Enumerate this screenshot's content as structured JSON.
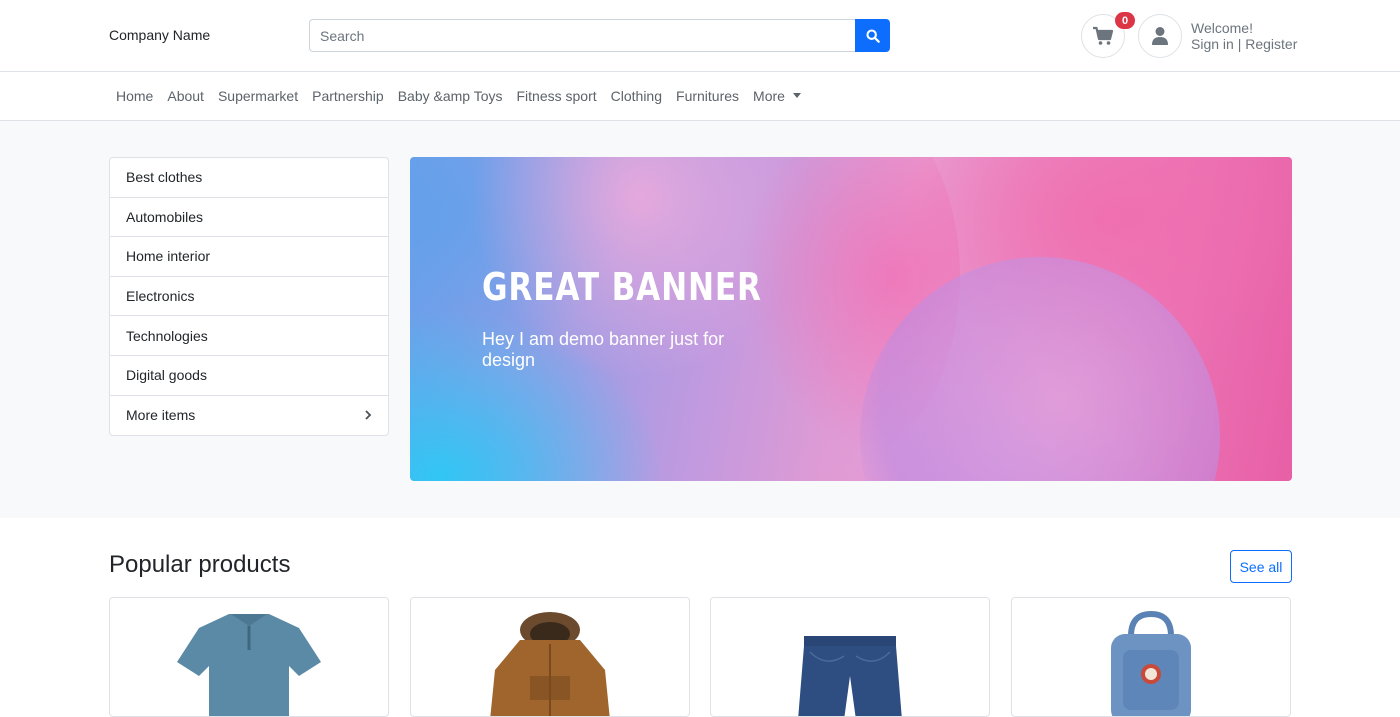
{
  "header": {
    "brand": "Company Name",
    "search_placeholder": "Search",
    "cart_count": "0",
    "welcome": "Welcome!",
    "sign_in": "Sign in",
    "separator": " | ",
    "register": "Register",
    "icons": {
      "search": "search-icon",
      "cart": "cart-icon",
      "user": "user-icon"
    },
    "accent_color": "#0d6efd",
    "badge_color": "#dc3545"
  },
  "nav": {
    "items": [
      "Home",
      "About",
      "Supermarket",
      "Partnership",
      "Baby &amp Toys",
      "Fitness sport",
      "Clothing",
      "Furnitures"
    ],
    "more": "More"
  },
  "categories": {
    "items": [
      "Best clothes",
      "Automobiles",
      "Home interior",
      "Electronics",
      "Technologies",
      "Digital goods"
    ],
    "more": "More items"
  },
  "banner": {
    "title": "Great Banner",
    "subtitle": "Hey I am demo banner just for design"
  },
  "popular": {
    "title": "Popular products",
    "see_all": "See all",
    "products": [
      {
        "image": "polo-shirt",
        "color": "#5b8aa6"
      },
      {
        "image": "brown-parka-jacket",
        "color": "#a0652c"
      },
      {
        "image": "denim-shorts",
        "color": "#2e4d80"
      },
      {
        "image": "blue-backpack",
        "color": "#6d93c2"
      }
    ]
  }
}
